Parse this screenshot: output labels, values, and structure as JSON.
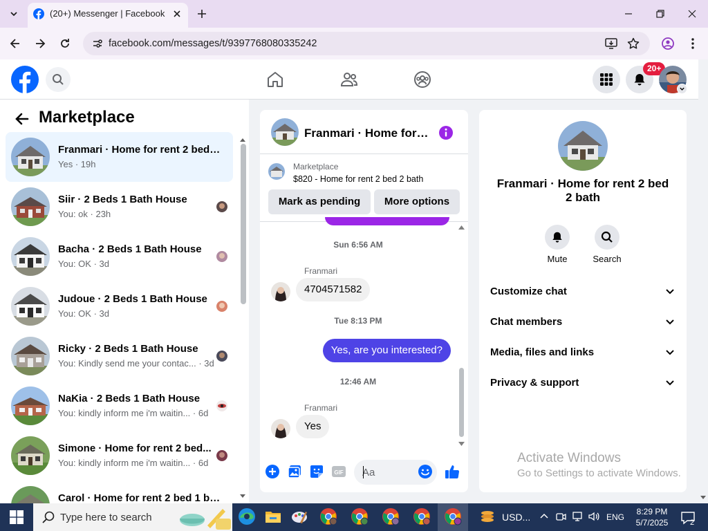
{
  "browser": {
    "tab_title": "(20+) Messenger | Facebook",
    "url": "facebook.com/messages/t/9397768080335242"
  },
  "topbar": {
    "notification_count": "20+"
  },
  "marketplace": {
    "heading": "Marketplace",
    "conversations": [
      {
        "title": "Franmari · Home for rent 2 bed 2 bath",
        "preview": "Yes",
        "time": "19h",
        "active": true
      },
      {
        "title": "Siir · 2 Beds 1 Bath House",
        "preview": "You: ok",
        "time": "23h",
        "active": false
      },
      {
        "title": "Bacha · 2 Beds 1 Bath House",
        "preview": "You: OK",
        "time": "3d",
        "active": false
      },
      {
        "title": "Judoue · 2 Beds 1 Bath House",
        "preview": "You: OK",
        "time": "3d",
        "active": false
      },
      {
        "title": "Ricky · 2 Beds 1 Bath House",
        "preview": "You: Kindly send me your contac...",
        "time": "3d",
        "active": false
      },
      {
        "title": "NaKia · 2 Beds 1 Bath House",
        "preview": "You: kindly inform me i'm waitin...",
        "time": "6d",
        "active": false
      },
      {
        "title": "Simone · Home for rent 2 bed...",
        "preview": "You: kindly inform me i'm waitin...",
        "time": "6d",
        "active": false
      },
      {
        "title": "Carol · Home for rent 2 bed 1 bath",
        "preview": "",
        "time": "",
        "active": false
      }
    ]
  },
  "chat": {
    "title": "Franmari · Home for rent 2 bed 2 bath",
    "listing_label": "Marketplace",
    "listing_text": "$820 - Home for rent 2 bed 2 bath",
    "mark_pending": "Mark as pending",
    "more_options": "More options",
    "timestamps": [
      "Sun 6:56 AM",
      "Tue 8:13 PM",
      "12:46 AM"
    ],
    "sender_name": "Franmari",
    "messages": {
      "phone": "4704571582",
      "outgoing": "Yes, are you interested?",
      "reply": "Yes"
    },
    "input_placeholder": "Aa"
  },
  "info_panel": {
    "title": "Franmari · Home for rent 2 bed 2 bath",
    "actions": {
      "mute": "Mute",
      "search": "Search"
    },
    "sections": [
      "Customize chat",
      "Chat members",
      "Media, files and links",
      "Privacy & support"
    ]
  },
  "watermark": {
    "line1": "Activate Windows",
    "line2": "Go to Settings to activate Windows."
  },
  "taskbar": {
    "search_placeholder": "Type here to search",
    "weather": "USD...",
    "language": "ENG",
    "time": "8:29 PM",
    "date": "5/7/2025",
    "notifications": "2"
  },
  "colors": {
    "facebook_blue": "#0866ff",
    "messenger_purple": "#9b26e6",
    "outgoing_bubble": "#4e43e6",
    "notification_red": "#e41e3f"
  }
}
